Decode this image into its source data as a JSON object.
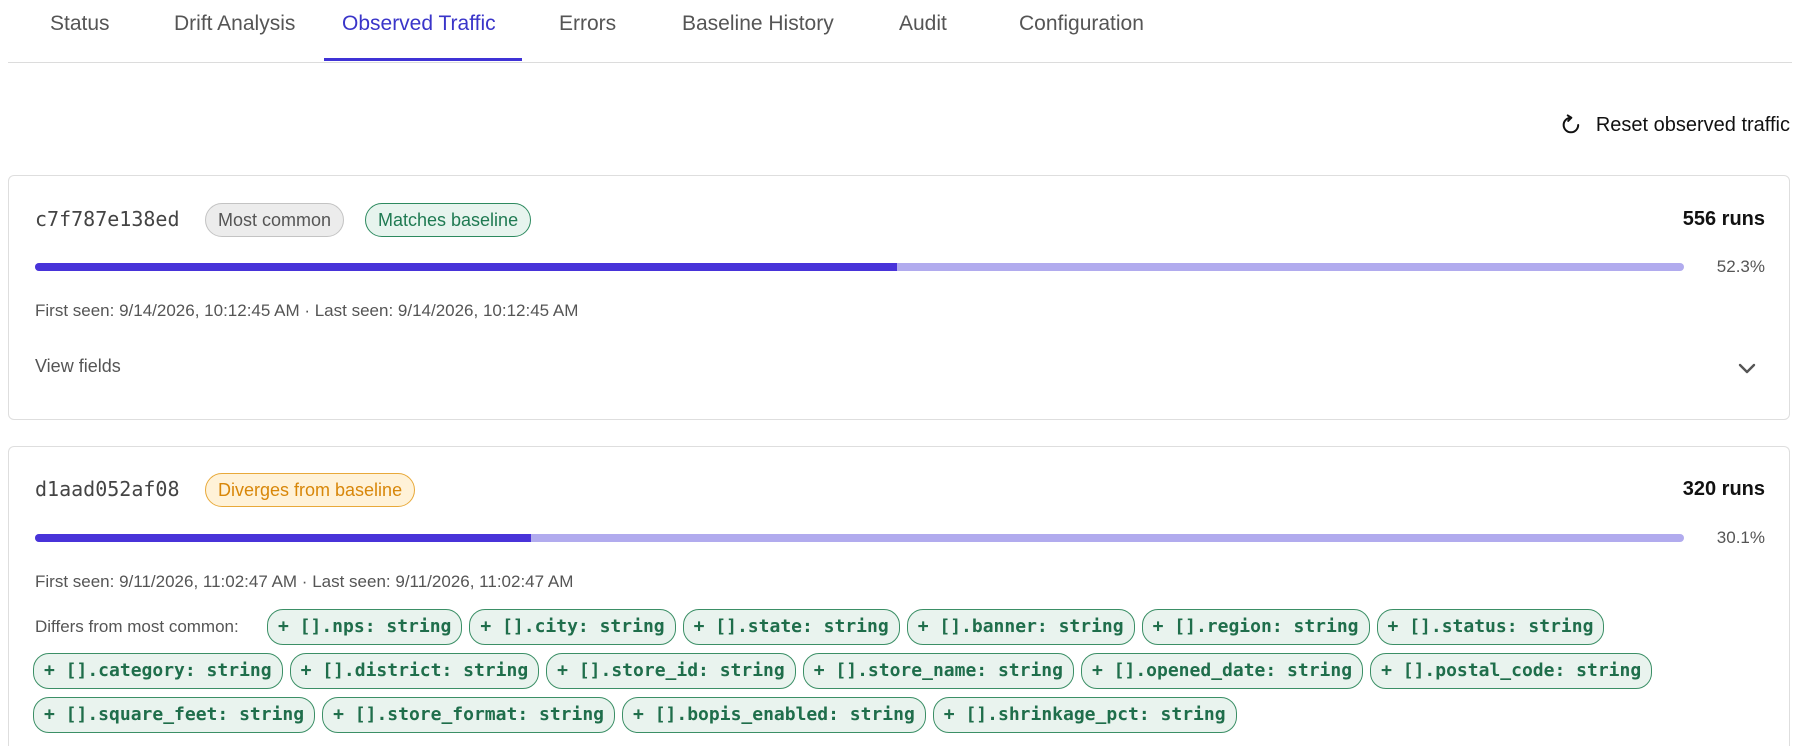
{
  "tabs": [
    {
      "label": "Status",
      "active": false
    },
    {
      "label": "Drift Analysis",
      "active": false
    },
    {
      "label": "Observed Traffic",
      "active": true
    },
    {
      "label": "Errors",
      "active": false
    },
    {
      "label": "Baseline History",
      "active": false
    },
    {
      "label": "Audit",
      "active": false
    },
    {
      "label": "Configuration",
      "active": false
    }
  ],
  "reset_label": "Reset observed traffic",
  "colors": {
    "accent": "#3f32d6",
    "bar_fill": "#4833d9",
    "bar_track": "#b1abee",
    "match_green": "#1f7a52",
    "diverge_orange": "#d8870a"
  },
  "icons": {
    "reset": "refresh-icon",
    "expand": "chevron-down-icon"
  },
  "shapes": [
    {
      "hash": "c7f787e138ed",
      "badges": [
        {
          "label": "Most common",
          "style": "gray"
        },
        {
          "label": "Matches baseline",
          "style": "green"
        }
      ],
      "runs": "556 runs",
      "percent": "52.3%",
      "share": 0.523,
      "seen": "First seen: 9/14/2026, 10:12:45 AM · Last seen: 9/14/2026, 10:12:45 AM",
      "view_fields": "View fields"
    },
    {
      "hash": "d1aad052af08",
      "badges": [
        {
          "label": "Diverges from baseline",
          "style": "orange"
        }
      ],
      "runs": "320 runs",
      "percent": "30.1%",
      "share": 0.301,
      "seen": "First seen: 9/11/2026, 11:02:47 AM · Last seen: 9/11/2026, 11:02:47 AM",
      "diff_label": "Differs from most common:",
      "diff_fields": [
        "+ [].nps: string",
        "+ [].city: string",
        "+ [].state: string",
        "+ [].banner: string",
        "+ [].region: string",
        "+ [].status: string",
        "+ [].category: string",
        "+ [].district: string",
        "+ [].store_id: string",
        "+ [].store_name: string",
        "+ [].opened_date: string",
        "+ [].postal_code: string",
        "+ [].square_feet: string",
        "+ [].store_format: string",
        "+ [].bopis_enabled: string",
        "+ [].shrinkage_pct: string"
      ]
    }
  ]
}
